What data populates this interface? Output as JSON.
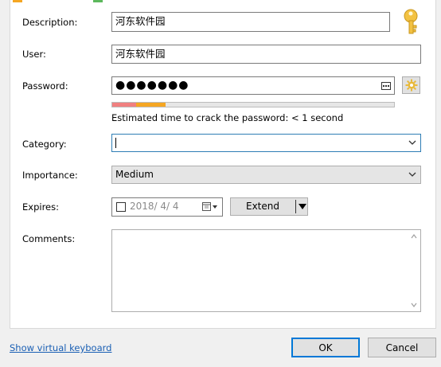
{
  "form": {
    "description_label": "Description:",
    "description_value": "河东软件园",
    "user_label": "User:",
    "user_value": "河东软件园",
    "password_label": "Password:",
    "password_value": "●●●●●●●",
    "strength_fraction": 0.19,
    "strength_colors": [
      "#f08080",
      "#f5a623"
    ],
    "estimate_text": "Estimated time to crack the password: < 1 second",
    "category_label": "Category:",
    "category_value": "",
    "importance_label": "Importance:",
    "importance_value": "Medium",
    "expires_label": "Expires:",
    "expires_checked": false,
    "expires_date": "2018/  4/  4",
    "extend_label": "Extend",
    "comments_label": "Comments:",
    "comments_value": ""
  },
  "footer": {
    "keyboard_link": "Show virtual keyboard",
    "ok_label": "OK",
    "cancel_label": "Cancel"
  },
  "icons": {
    "key": "key-icon",
    "gear": "gear-icon",
    "password_dots": "ellipsis-icon",
    "calendar": "calendar-icon"
  },
  "colors": {
    "accent": "#0078d7",
    "focus_border": "#2e7eb5",
    "link": "#1a5fb4",
    "key_gold": "#f3c242",
    "gear_gold": "#e8b93a",
    "top_accent_orange": "#f5a623",
    "top_accent_green": "#5cb85c"
  }
}
